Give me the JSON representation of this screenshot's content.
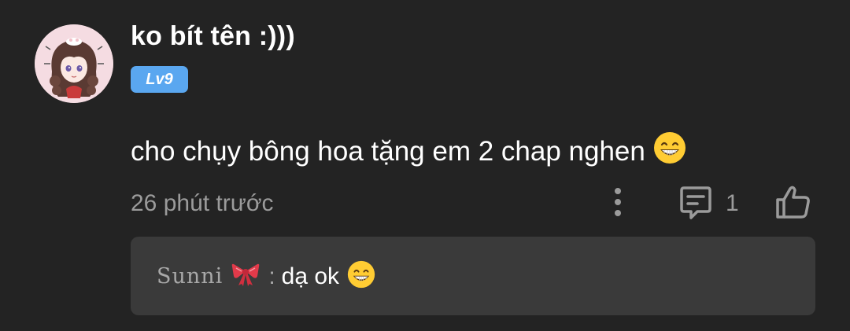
{
  "comment": {
    "username": "ko bít tên :)))",
    "level": "Lv9",
    "text": "cho chụy bông hoa tặng em 2 chap nghen",
    "text_emoji": "grinning-face-emoji",
    "timestamp": "26 phút trước",
    "reply_count": "1",
    "avatar": "anime-girl-avatar"
  },
  "reply": {
    "author": "Sunni",
    "author_decoration": "red-bow-emoji",
    "separator": ":",
    "text": "dạ ok",
    "text_emoji": "grinning-face-emoji"
  },
  "colors": {
    "background": "#232323",
    "reply_box": "#3a3a3a",
    "level_badge": "#5aa7f0",
    "muted_text": "#9b9b9b"
  },
  "icons": {
    "more": "more-vertical-icon",
    "reply": "comment-bubble-icon",
    "like": "thumbs-up-icon"
  }
}
